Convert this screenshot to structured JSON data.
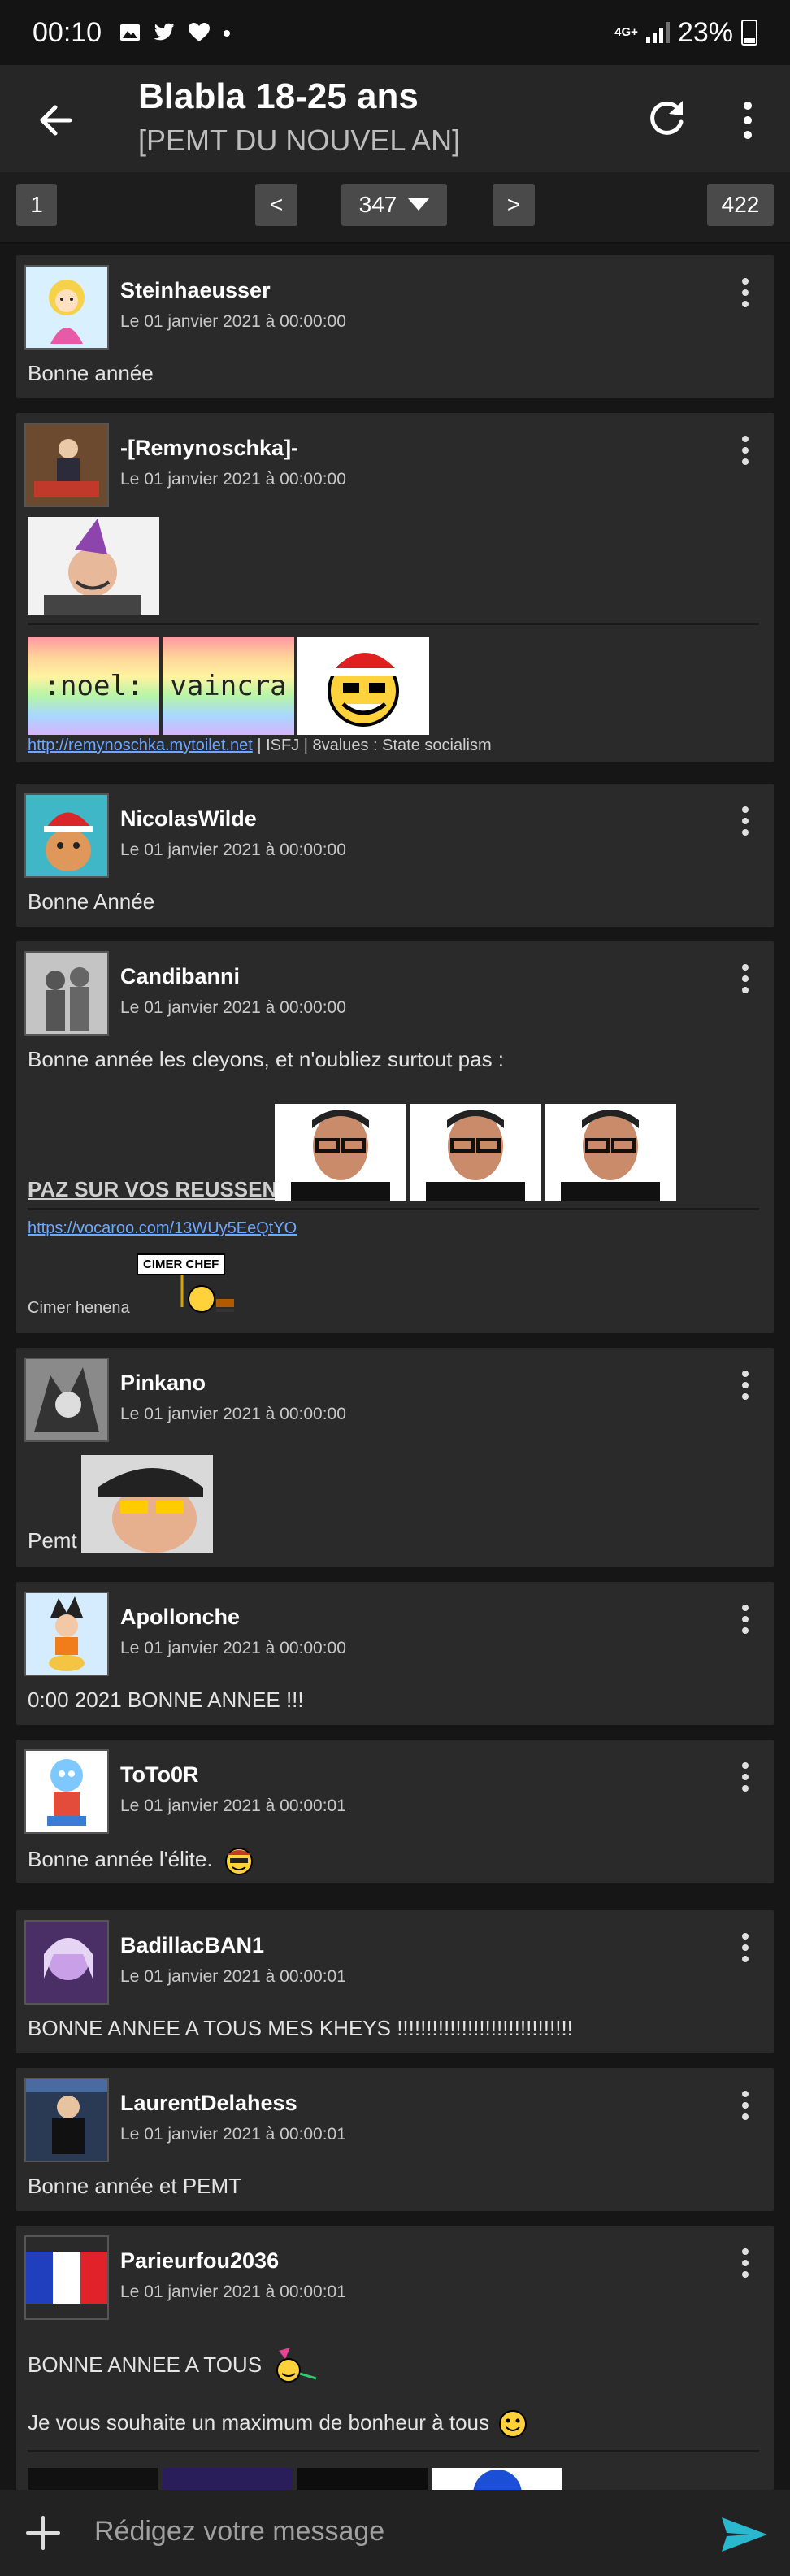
{
  "status_bar": {
    "time": "00:10",
    "network": "4G+",
    "battery": "23%"
  },
  "app_bar": {
    "title": "Blabla 18-25 ans",
    "subtitle": "[PEMT DU NOUVEL AN]"
  },
  "pager": {
    "first": "1",
    "prev": "<",
    "current": "347",
    "next": ">",
    "last": "422"
  },
  "posts": [
    {
      "author": "Steinhaeusser",
      "date": "Le 01 janvier 2021 à 00:00:00",
      "text": "Bonne année"
    },
    {
      "author": "-[Remynoschka]-",
      "date": "Le 01 janvier 2021 à 00:00:00",
      "sticker_1": ":noel:",
      "sticker_2": "vaincra",
      "sig_link": "http://remynoschka.mytoilet.net",
      "sig_text": " | ISFJ | 8values : State socialism"
    },
    {
      "author": "NicolasWilde",
      "date": "Le 01 janvier 2021 à 00:00:00",
      "text": "Bonne Année"
    },
    {
      "author": "Candibanni",
      "date": "Le 01 janvier 2021 à 00:00:00",
      "text": "Bonne année les cleyons, et n'oubliez surtout pas :",
      "bold": "PAZ SUR VOS REUSSENT",
      "sig_link": "https://vocaroo.com/13WUy5EeQtYO",
      "sig_text": "Cimer henena",
      "sign": "CIMER CHEF"
    },
    {
      "author": "Pinkano",
      "date": "Le 01 janvier 2021 à 00:00:00",
      "text": "Pemt"
    },
    {
      "author": "Apollonche",
      "date": "Le 01 janvier 2021 à 00:00:00",
      "text": "0:00 2021 BONNE ANNEE !!!"
    },
    {
      "author": "ToTo0R",
      "date": "Le 01 janvier 2021 à 00:00:01",
      "text": "Bonne année l'élite."
    },
    {
      "author": "BadillacBAN1",
      "date": "Le 01 janvier 2021 à 00:00:01",
      "text": "BONNE ANNEE A TOUS MES KHEYS !!!!!!!!!!!!!!!!!!!!!!!!!!!!!!"
    },
    {
      "author": "LaurentDelahess",
      "date": "Le 01 janvier 2021 à 00:00:01",
      "text": "Bonne année et PEMT"
    },
    {
      "author": "Parieurfou2036",
      "date": "Le 01 janvier 2021 à 00:00:01",
      "text": "BONNE ANNEE A TOUS",
      "text_2": "Je vous souhaite un maximum de bonheur à tous"
    }
  ],
  "composer": {
    "placeholder": "Rédigez votre message"
  },
  "icons": {
    "back": "arrow-back-icon",
    "refresh": "refresh-icon",
    "menu": "more-vert-icon",
    "add": "plus-icon",
    "send": "send-icon",
    "dropdown": "caret-down-icon"
  },
  "colors": {
    "accent": "#2ab7d0",
    "link": "#6da7ff",
    "background": "#161616",
    "card": "#2a2a2a"
  }
}
